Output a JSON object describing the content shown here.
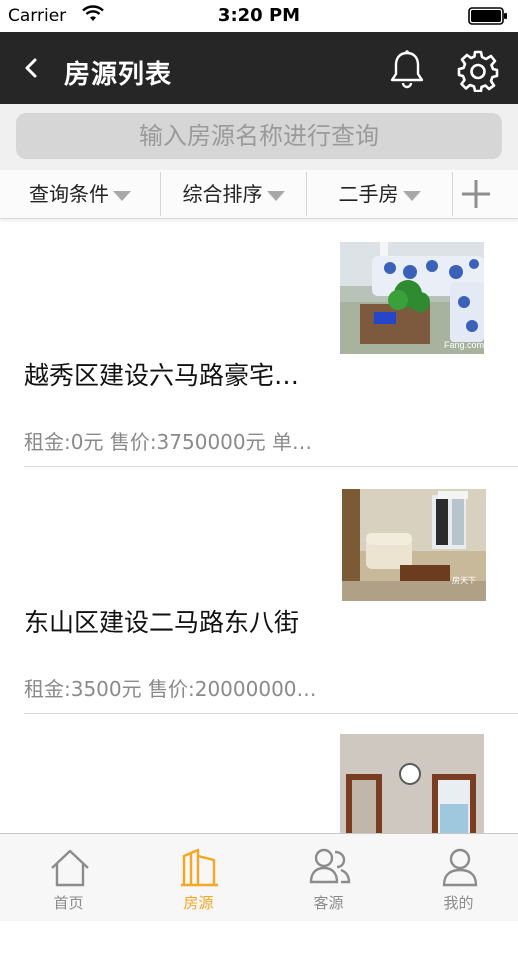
{
  "status_bar": {
    "carrier": "Carrier",
    "time": "3:20 PM"
  },
  "nav": {
    "title": "房源列表",
    "icons": [
      "back-icon",
      "bell-icon",
      "gear-icon"
    ]
  },
  "search": {
    "placeholder": "输入房源名称进行查询"
  },
  "filters": [
    {
      "label": "查询条件"
    },
    {
      "label": "综合排序"
    },
    {
      "label": "二手房"
    }
  ],
  "listings": [
    {
      "name": "越秀区建设六马路豪宅…",
      "price": "租金:0元 售价:3750000元 单…"
    },
    {
      "name": "东山区建设二马路东八街",
      "price": "租金:3500元 售价:20000000…"
    },
    {
      "name": "",
      "price": ""
    }
  ],
  "tabs": [
    {
      "label": "首页",
      "icon": "home-icon",
      "active": false
    },
    {
      "label": "房源",
      "icon": "building-icon",
      "active": true
    },
    {
      "label": "客源",
      "icon": "clients-icon",
      "active": false
    },
    {
      "label": "我的",
      "icon": "user-icon",
      "active": false
    }
  ],
  "colors": {
    "accent": "#f5a623",
    "nav_bg": "#262626",
    "inactive": "#8c8c8c"
  }
}
